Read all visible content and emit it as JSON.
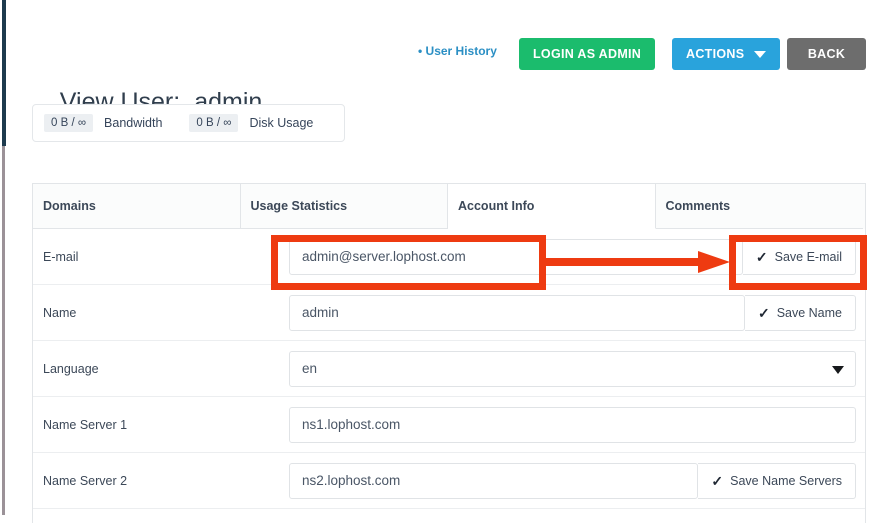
{
  "header": {
    "title_label": "View User:",
    "title_value": "admin",
    "user_history_link": "• User History",
    "buttons": [
      {
        "name": "login-as-admin-button",
        "label": "LOGIN AS ADMIN",
        "color": "#1bbc6d"
      },
      {
        "name": "actions-button",
        "label": "ACTIONS",
        "color": "#29a3dc",
        "icon": "chevron-down-icon"
      },
      {
        "name": "back-button",
        "label": "BACK",
        "color": "#6d6d6d"
      }
    ]
  },
  "usage": {
    "bandwidth_value": "0 B / ∞",
    "bandwidth_label": "Bandwidth",
    "disk_value": "0 B / ∞",
    "disk_label": "Disk Usage"
  },
  "tabs": [
    {
      "label": "Domains",
      "active": false
    },
    {
      "label": "Usage Statistics",
      "active": false
    },
    {
      "label": "Account Info",
      "active": true
    },
    {
      "label": "Comments",
      "active": false
    }
  ],
  "form": {
    "email": {
      "label": "E-mail",
      "value": "admin@server.lophost.com",
      "placeholder": "E-mail",
      "save_label": "Save E-mail",
      "save_icon": "check-icon"
    },
    "name": {
      "label": "Name",
      "value": "admin",
      "placeholder": "Name",
      "save_label": "Save Name",
      "save_icon": "check-icon"
    },
    "language": {
      "label": "Language",
      "value": "en",
      "options": [
        "en"
      ],
      "caret_icon": "chevron-down-icon"
    },
    "ns1": {
      "label": "Name Server 1",
      "value": "ns1.lophost.com",
      "placeholder": "Name Server 1"
    },
    "ns2": {
      "label": "Name Server 2",
      "value": "ns2.lophost.com",
      "placeholder": "Name Server 2",
      "save_label": "Save Name Servers",
      "save_icon": "check-icon"
    }
  },
  "annotations": {
    "color": "#ee3b11",
    "box_email_input": "highlight-email-input",
    "box_save_email": "highlight-save-email-button",
    "arrow": "arrow-pointing-to-save-email"
  }
}
